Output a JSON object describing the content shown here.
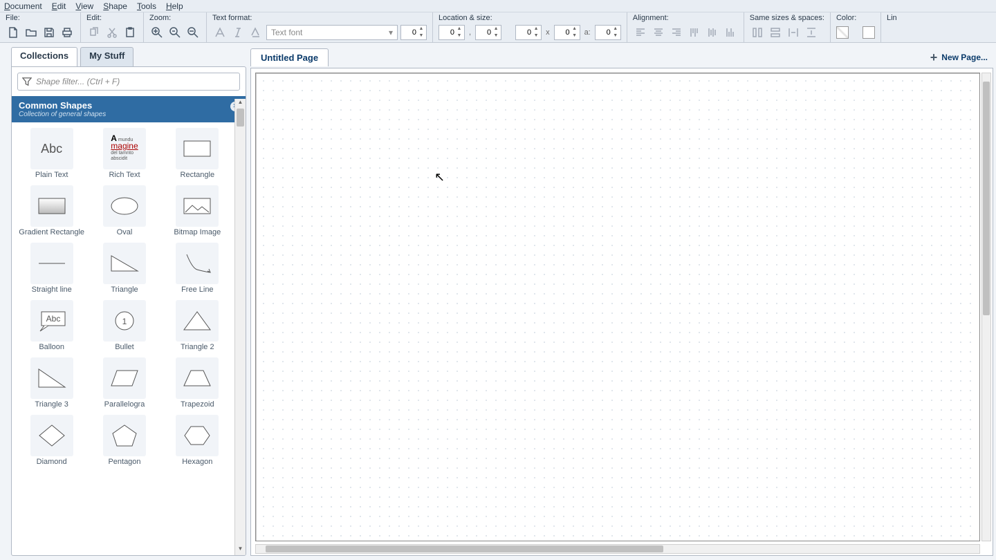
{
  "menu": {
    "document": "Document",
    "edit": "Edit",
    "view": "View",
    "shape": "Shape",
    "tools": "Tools",
    "help": "Help"
  },
  "toolbar": {
    "file_label": "File:",
    "edit_label": "Edit:",
    "zoom_label": "Zoom:",
    "text_format_label": "Text format:",
    "location_size_label": "Location & size:",
    "alignment_label": "Alignment:",
    "same_sizes_label": "Same sizes & spaces:",
    "color_label": "Color:",
    "line_label": "Lin",
    "font_placeholder": "Text font",
    "fontsize_value": "0",
    "loc_x": "0",
    "loc_y": "0",
    "size_w": "0",
    "size_h": "0",
    "angle": "0",
    "sep_comma": ",",
    "sep_x": "x",
    "sep_a": "a:"
  },
  "sidebar": {
    "tabs": {
      "collections": "Collections",
      "mystuff": "My Stuff"
    },
    "filter_placeholder": "Shape filter... (Ctrl + F)",
    "collection": {
      "title": "Common Shapes",
      "subtitle": "Collection of general shapes"
    },
    "shapes": [
      {
        "label": "Plain Text"
      },
      {
        "label": "Rich Text"
      },
      {
        "label": "Rectangle"
      },
      {
        "label": "Gradient Rectangle"
      },
      {
        "label": "Oval"
      },
      {
        "label": "Bitmap Image"
      },
      {
        "label": "Straight line"
      },
      {
        "label": "Triangle"
      },
      {
        "label": "Free Line"
      },
      {
        "label": "Balloon"
      },
      {
        "label": "Bullet"
      },
      {
        "label": "Triangle 2"
      },
      {
        "label": "Triangle 3"
      },
      {
        "label": "Parallelogra"
      },
      {
        "label": "Trapezoid"
      },
      {
        "label": "Diamond"
      },
      {
        "label": "Pentagon"
      },
      {
        "label": "Hexagon"
      }
    ]
  },
  "pages": {
    "tab0": "Untitled Page",
    "newpage": "New Page..."
  }
}
